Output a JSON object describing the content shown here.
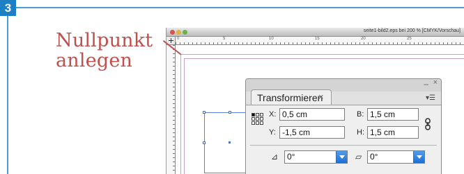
{
  "step": {
    "number": "3"
  },
  "caption": {
    "line1": "Nullpunkt",
    "line2": "anlegen"
  },
  "document": {
    "title": "seite1-bild2.eps bei 200 % [CMYK/Vorschau]",
    "ruler_numbers": [
      "0",
      "5",
      "10",
      "15",
      "20",
      "25"
    ]
  },
  "transform_panel": {
    "tab_label": "Transformieren",
    "close_glyph": "×",
    "minimize_glyph": "–",
    "menu_glyph": "▾☰",
    "x": {
      "label": "X:",
      "value": "0,5 cm"
    },
    "y": {
      "label": "Y:",
      "value": "-1,5 cm"
    },
    "width": {
      "label": "B:",
      "value": "1,5 cm"
    },
    "height": {
      "label": "H:",
      "value": "1,5 cm"
    },
    "rotation": {
      "icon": "rotation-angle-icon",
      "glyph": "⊿",
      "value": "0°"
    },
    "shear": {
      "icon": "shear-angle-icon",
      "glyph": "▱",
      "value": "0°"
    },
    "reference_point_selected": "top-left"
  },
  "colors": {
    "caption": "#c0504d",
    "badge": "#1d7fc4",
    "dropdown_accent": "#2a7ee0"
  }
}
